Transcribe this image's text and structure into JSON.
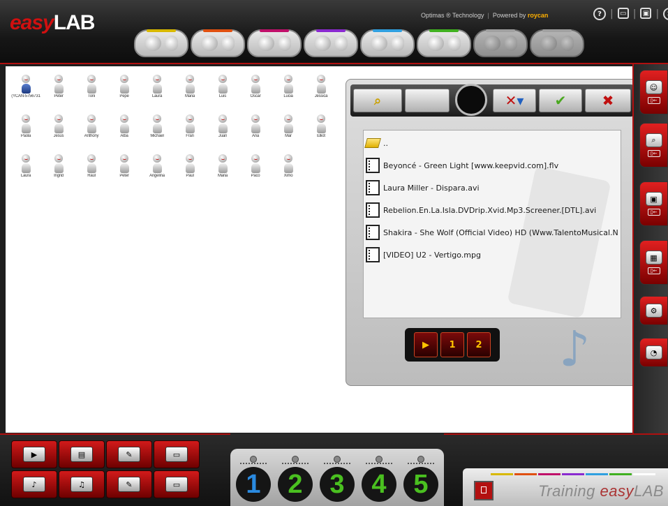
{
  "app": {
    "logo_prefix": "easy",
    "logo_suffix": "LAB",
    "credits_left": "Optimas ® Technology",
    "credits_sep": "|",
    "credits_right": "Powered by",
    "credits_brand": "roycan"
  },
  "window_buttons": [
    "?",
    "▭",
    "▣",
    "✕"
  ],
  "groups": [
    {
      "color": "#d8b800",
      "active": true
    },
    {
      "color": "#e05010",
      "active": true
    },
    {
      "color": "#c0106a",
      "active": true
    },
    {
      "color": "#8a2ad0",
      "active": true
    },
    {
      "color": "#30a0e0",
      "active": true
    },
    {
      "color": "#40b020",
      "active": true
    },
    {
      "color": "#cccccc",
      "active": false
    },
    {
      "color": "#cccccc",
      "active": false
    }
  ],
  "students": [
    {
      "name": "(YCAN-5756731",
      "teacher": true
    },
    {
      "name": "Peter"
    },
    {
      "name": "Toni"
    },
    {
      "name": "Pepe"
    },
    {
      "name": "Laura"
    },
    {
      "name": "Maria"
    },
    {
      "name": "Luis"
    },
    {
      "name": "Óscar"
    },
    {
      "name": "Lucia"
    },
    {
      "name": "Jessica"
    },
    {
      "name": "Paola"
    },
    {
      "name": "Jesús"
    },
    {
      "name": "Anthony"
    },
    {
      "name": "Alba"
    },
    {
      "name": "Michael"
    },
    {
      "name": "Fran"
    },
    {
      "name": "Juan"
    },
    {
      "name": "Ana"
    },
    {
      "name": "Mar"
    },
    {
      "name": "Elliot"
    },
    {
      "name": "Laura"
    },
    {
      "name": "Ingrid"
    },
    {
      "name": "Raúl"
    },
    {
      "name": "Peter"
    },
    {
      "name": "Angelina"
    },
    {
      "name": "Paul"
    },
    {
      "name": "Maria"
    },
    {
      "name": "Paco"
    },
    {
      "name": "Ximo"
    }
  ],
  "file_panel": {
    "toolbar_icons": [
      "folder-search-icon",
      "blank",
      "record-circle",
      "filter-remove-icon",
      "check-icon",
      "close-icon"
    ],
    "files": [
      {
        "name": "..",
        "type": "folder"
      },
      {
        "name": "Beyoncé - Green Light [www.keepvid.com].flv",
        "type": "video"
      },
      {
        "name": "Laura Miller - Dispara.avi",
        "type": "video"
      },
      {
        "name": "Rebelion.En.La.Isla.DVDrip.Xvid.Mp3.Screener.[DTL].avi",
        "type": "video"
      },
      {
        "name": "Shakira - She Wolf (Official Video) HD (Www.TalentoMusical.N",
        "type": "video"
      },
      {
        "name": "[VIDEO] U2 - Vertigo.mpg",
        "type": "video"
      }
    ],
    "bottom_buttons": [
      "send-to-student",
      "1",
      "2"
    ]
  },
  "right_buttons": [
    {
      "name": "students-group-button",
      "icon": "group-icon"
    },
    {
      "name": "remote-screen-button",
      "icon": "monitor-search-icon"
    },
    {
      "name": "projector-button",
      "icon": "projector-icon"
    },
    {
      "name": "keyboard-lock-button",
      "icon": "keyboard-icon"
    },
    {
      "name": "settings-users-button",
      "icon": "gear-users-icon"
    },
    {
      "name": "speed-gauge-button",
      "icon": "gauge-icon"
    }
  ],
  "bottom_buttons": [
    "broadcast-video-button",
    "send-files-button",
    "film-pen-button",
    "teacher-screen-button",
    "broadcast-audio-button",
    "send-music-button",
    "music-pen-button",
    "student-screen-button"
  ],
  "channels": [
    {
      "label": "1",
      "color": "#2a8ae0"
    },
    {
      "label": "2",
      "color": "#4ac020"
    },
    {
      "label": "3",
      "color": "#4ac020"
    },
    {
      "label": "4",
      "color": "#4ac020"
    },
    {
      "label": "5",
      "color": "#4ac020"
    }
  ],
  "training": {
    "label_prefix": "Training",
    "label_logo_prefix": "easy",
    "label_logo_suffix": "LAB",
    "colors": [
      "#d8b800",
      "#e05010",
      "#c0106a",
      "#8a2ad0",
      "#30a0e0",
      "#40b020",
      "#ffffff"
    ]
  }
}
